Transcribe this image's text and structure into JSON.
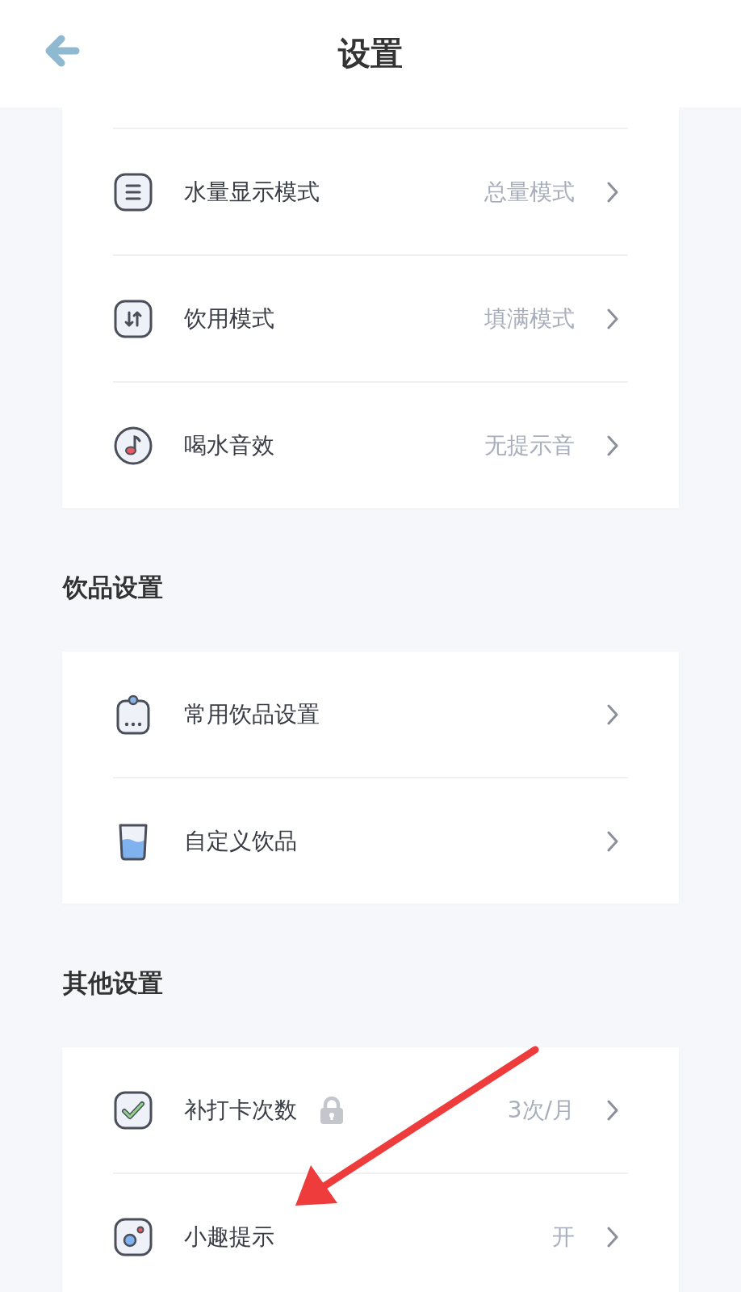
{
  "header": {
    "title": "设置"
  },
  "sections": [
    {
      "items": [
        {
          "label": "水量显示模式",
          "value": "总量模式"
        },
        {
          "label": "饮用模式",
          "value": "填满模式"
        },
        {
          "label": "喝水音效",
          "value": "无提示音"
        }
      ]
    },
    {
      "title": "饮品设置",
      "items": [
        {
          "label": "常用饮品设置"
        },
        {
          "label": "自定义饮品"
        }
      ]
    },
    {
      "title": "其他设置",
      "items": [
        {
          "label": "补打卡次数",
          "locked": true,
          "value": "3次/月"
        },
        {
          "label": "小趣提示",
          "value": "开"
        }
      ]
    }
  ],
  "annotation": {
    "kind": "arrow"
  }
}
